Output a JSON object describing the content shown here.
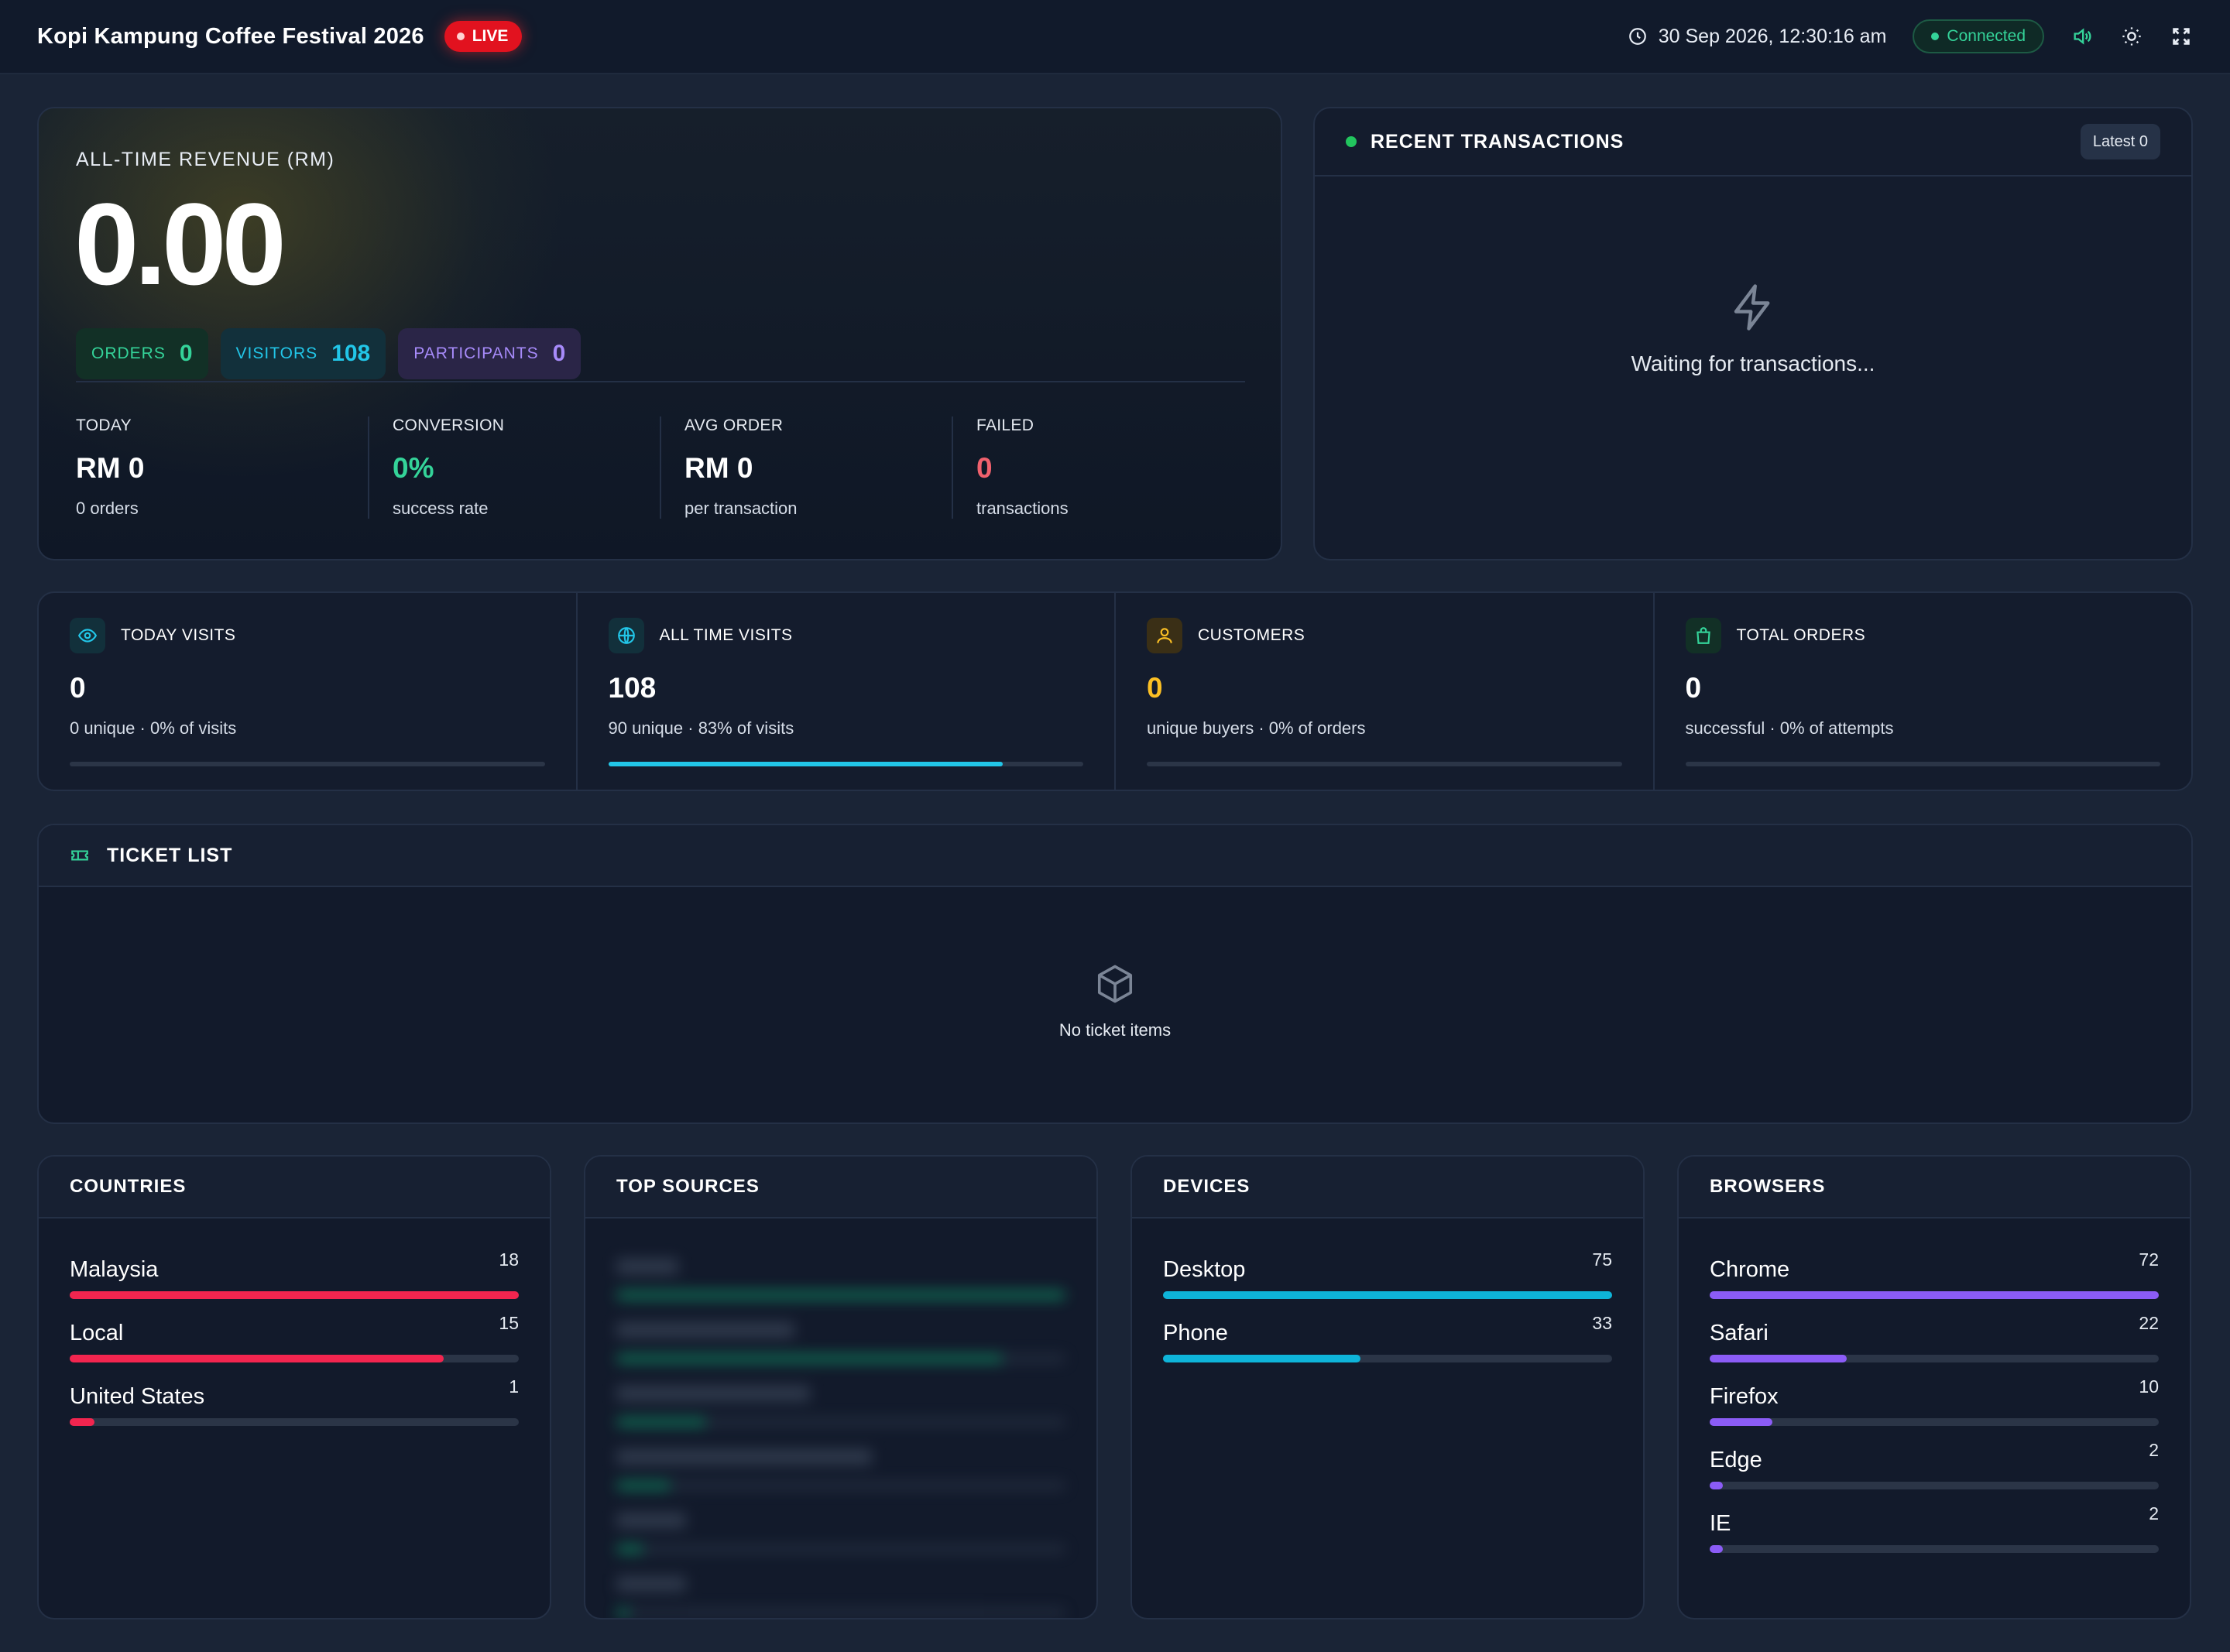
{
  "header": {
    "title": "Kopi Kampung Coffee Festival 2026",
    "live_label": "LIVE",
    "datetime": "30 Sep 2026, 12:30:16 am",
    "connection": "Connected",
    "icons": [
      "clock-icon",
      "sound-icon",
      "sun-icon",
      "fullscreen-icon"
    ]
  },
  "revenue": {
    "label": "ALL-TIME REVENUE (RM)",
    "value": "0.00",
    "pills": {
      "orders": {
        "label": "ORDERS",
        "value": "0"
      },
      "visitors": {
        "label": "VISITORS",
        "value": "108"
      },
      "participants": {
        "label": "PARTICIPANTS",
        "value": "0"
      }
    },
    "stats": [
      {
        "label": "TODAY",
        "value": "RM 0",
        "sub": "0 orders",
        "color": "#ffffff"
      },
      {
        "label": "CONVERSION",
        "value": "0%",
        "sub": "success rate",
        "color": "#34d399"
      },
      {
        "label": "AVG ORDER",
        "value": "RM 0",
        "sub": "per transaction",
        "color": "#ffffff"
      },
      {
        "label": "FAILED",
        "value": "0",
        "sub": "transactions",
        "color": "#f0616d"
      }
    ]
  },
  "recent": {
    "title": "RECENT TRANSACTIONS",
    "badge": "Latest 0",
    "empty_icon": "lightning-icon",
    "empty_text": "Waiting for transactions..."
  },
  "metrics": [
    {
      "title": "TODAY VISITS",
      "icon": "eye-icon",
      "value": "0",
      "sub": "0 unique · 0% of visits",
      "progress": 0,
      "value_color": "#ffffff",
      "icon_color": "#22c6e8",
      "icon_bg": "#12303b"
    },
    {
      "title": "ALL TIME VISITS",
      "icon": "globe-icon",
      "value": "108",
      "sub": "90 unique · 83% of visits",
      "progress": 83,
      "value_color": "#ffffff",
      "icon_color": "#22c6e8",
      "icon_bg": "#12303b"
    },
    {
      "title": "CUSTOMERS",
      "icon": "user-icon",
      "value": "0",
      "sub": "unique buyers · 0% of orders",
      "progress": 0,
      "value_color": "#fbbf24",
      "icon_color": "#fbbf24",
      "icon_bg": "#3a2f16"
    },
    {
      "title": "TOTAL ORDERS",
      "icon": "shopping-bag-icon",
      "value": "0",
      "sub": "successful · 0% of attempts",
      "progress": 0,
      "value_color": "#ffffff",
      "icon_color": "#34d399",
      "icon_bg": "#123026"
    }
  ],
  "tickets": {
    "title": "TICKET LIST",
    "icon": "ticket-icon",
    "empty_icon": "box-icon",
    "empty_text": "No ticket items"
  },
  "panels": {
    "countries": {
      "title": "COUNTRIES",
      "color": "#f2254f",
      "max": 18,
      "rows": [
        {
          "name": "Malaysia",
          "count": 18
        },
        {
          "name": "Local",
          "count": 15
        },
        {
          "name": "United States",
          "count": 1
        }
      ]
    },
    "sources": {
      "title": "TOP SOURCES",
      "color": "#0f9d6b",
      "blurred": true
    },
    "devices": {
      "title": "DEVICES",
      "color": "#0eb4d9",
      "max": 75,
      "rows": [
        {
          "name": "Desktop",
          "count": 75
        },
        {
          "name": "Phone",
          "count": 33
        }
      ]
    },
    "browsers": {
      "title": "BROWSERS",
      "color": "#8b5cf6",
      "max": 72,
      "rows": [
        {
          "name": "Chrome",
          "count": 72
        },
        {
          "name": "Safari",
          "count": 22
        },
        {
          "name": "Firefox",
          "count": 10
        },
        {
          "name": "Edge",
          "count": 2
        },
        {
          "name": "IE",
          "count": 2
        }
      ]
    }
  }
}
